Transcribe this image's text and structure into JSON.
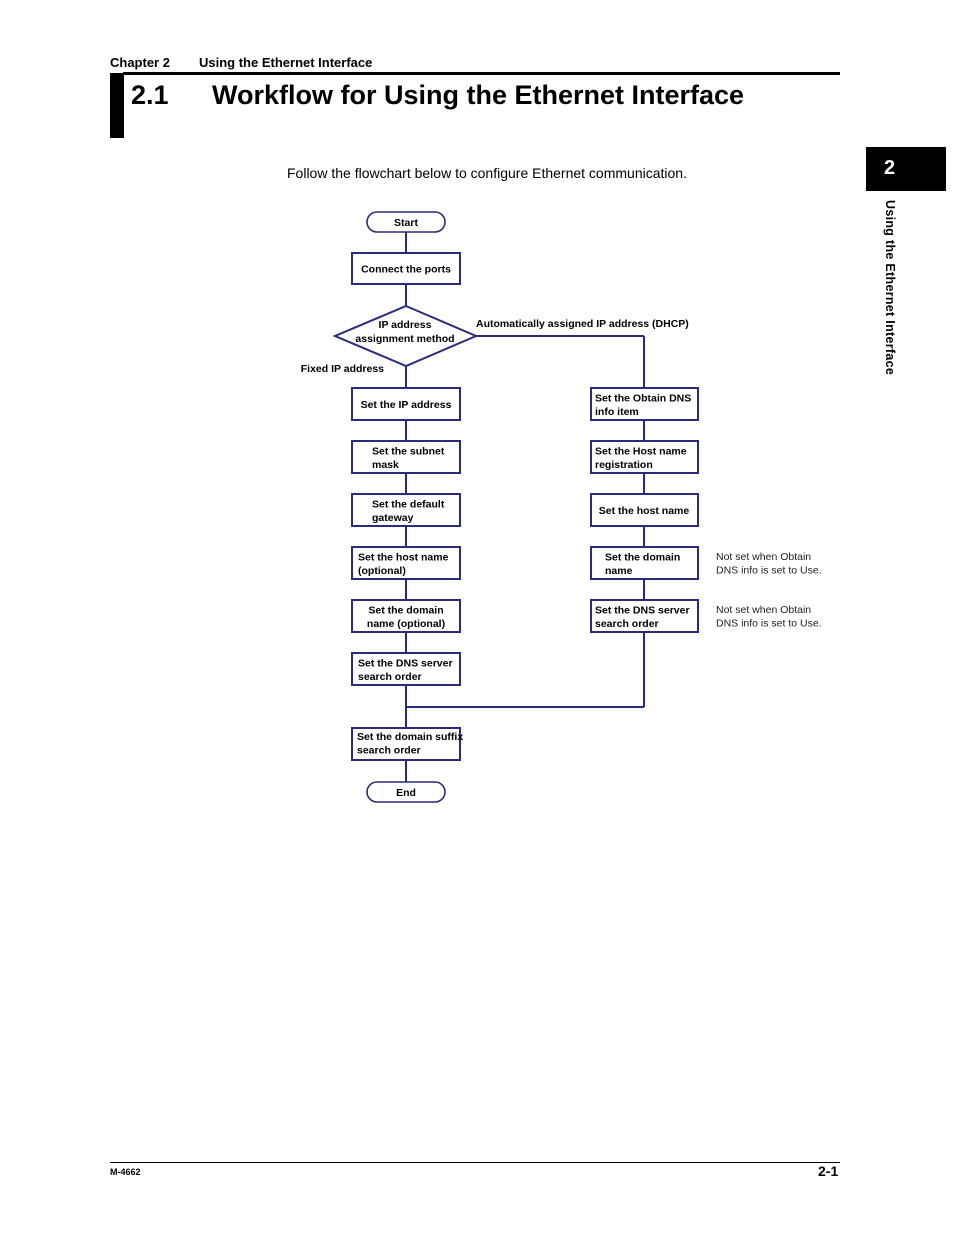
{
  "header": {
    "chapter_label": "Chapter 2",
    "chapter_title": "Using the Ethernet Interface",
    "section_number": "2.1",
    "section_title": "Workflow for Using the Ethernet Interface"
  },
  "side_tab": {
    "number": "2",
    "label": "Using the Ethernet Interface"
  },
  "intro_text": "Follow the flowchart below to configure Ethernet communication.",
  "flowchart": {
    "start": "Start",
    "connect": "Connect the ports",
    "decision": [
      "IP address",
      "assignment method"
    ],
    "branch_fixed": "Fixed IP address",
    "branch_dhcp": "Automatically assigned IP address (DHCP)",
    "left_steps": [
      [
        "Set the IP address"
      ],
      [
        "Set the subnet",
        "mask"
      ],
      [
        "Set the default",
        "gateway"
      ],
      [
        "Set the host name",
        "(optional)"
      ],
      [
        "Set the domain",
        "name (optional)"
      ],
      [
        "Set the DNS server",
        "search order"
      ]
    ],
    "right_steps": [
      [
        "Set the Obtain DNS",
        "info item"
      ],
      [
        "Set the Host name",
        "registration"
      ],
      [
        "Set the host name"
      ],
      [
        "Set the domain",
        "name"
      ],
      [
        "Set the DNS server",
        "search order"
      ]
    ],
    "right_notes": [
      null,
      null,
      null,
      [
        "Not set when Obtain",
        "DNS info is set to Use."
      ],
      [
        "Not set when Obtain",
        "DNS info is set to Use."
      ]
    ],
    "merge_step": [
      "Set the domain suffix",
      "search order"
    ],
    "end": "End",
    "line_color": "#2b2a7c"
  },
  "footer": {
    "doc_code": "M-4662",
    "page_number": "2-1"
  }
}
